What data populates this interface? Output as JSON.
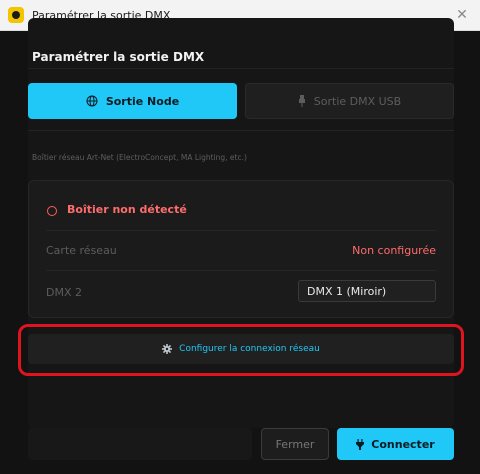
{
  "window": {
    "title": "Paramétrer la sortie DMX",
    "close_label": "✕"
  },
  "dialog": {
    "heading": "Paramétrer la sortie DMX",
    "tabs": [
      {
        "label": "Sortie Node",
        "icon": "globe-icon",
        "selected": true
      },
      {
        "label": "Sortie DMX USB",
        "icon": "usb-plug-icon",
        "selected": false
      }
    ],
    "section_label": "Boîtier réseau Art-Net (ElectroConcept, MA Lighting, etc.)",
    "device": {
      "status_text": "Boîtier non détecté",
      "status_icon": "empty-circle-icon",
      "rows": [
        {
          "label": "Carte réseau",
          "value": "Non configurée"
        },
        {
          "label": "DMX 2",
          "value": "DMX 1 (Miroir)"
        }
      ]
    },
    "config_button": {
      "label": "Configurer la connexion réseau",
      "icon": "gear-icon"
    },
    "footer": {
      "close_label": "Fermer",
      "connect_label": "Connecter",
      "connect_icon": "plug-icon"
    }
  },
  "colors": {
    "accent": "#1fc8f6",
    "error": "#ff6b6b",
    "highlight": "#e0141f",
    "background": "#121212"
  }
}
